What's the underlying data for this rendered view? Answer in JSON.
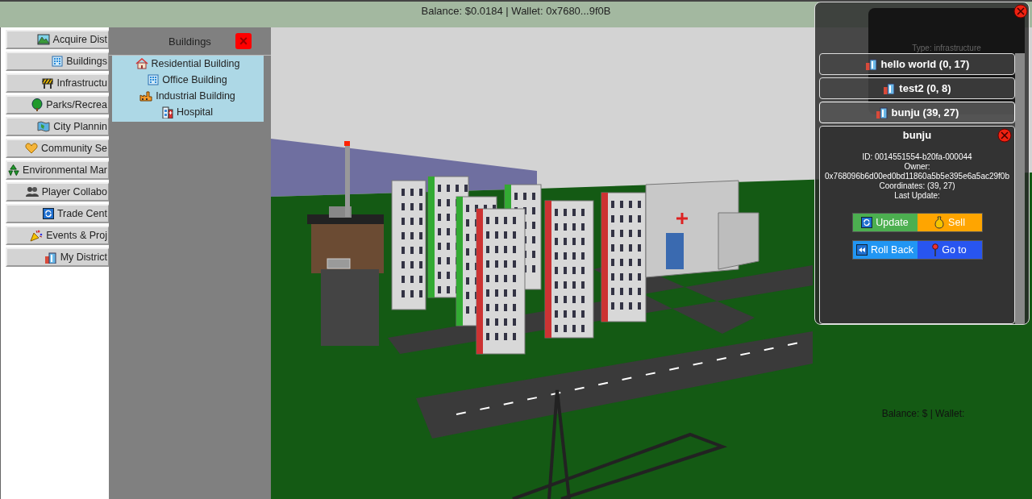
{
  "top_bar": {
    "text": "Balance: $0.0184 | Wallet: 0x7680...9f0B"
  },
  "menu": {
    "items": [
      "Acquire Dist",
      "Buildings",
      "Infrastructu",
      "Parks/Recrea",
      "City Plannin",
      "Community Se",
      "Environmental Mar",
      "Player Collabo",
      "Trade Cent",
      "Events & Proj",
      "My District"
    ]
  },
  "buildings_panel": {
    "title": "Buildings",
    "close": "×",
    "items": [
      "Residential Building",
      "Office Building",
      "Industrial Building",
      "Hospital"
    ]
  },
  "districts_panel": {
    "back_card": {
      "text": "Type: infrastructure"
    },
    "districts": [
      {
        "label": "hello world (0, 17)",
        "expanded": false
      },
      {
        "label": "test2 (0, 8)",
        "expanded": false
      },
      {
        "label": "bunju (39, 27)",
        "expanded": true
      }
    ],
    "detail": {
      "title": "bunju",
      "lines": [
        "ID: 0014551554-b20fa-000044",
        "Owner:",
        "0x768096b6d00ed0bd11860a5b5e395e6a5ac29f0b",
        "Coordinates: (39, 27)",
        "Last Update:"
      ],
      "button_rows": [
        [
          {
            "label": "Update",
            "color": "#4caf50"
          },
          {
            "label": "Sell",
            "color": "#ffa500"
          }
        ],
        [
          {
            "label": "Roll Back",
            "color": "#2196f3"
          },
          {
            "label": "Go to",
            "color": "#2855f0"
          }
        ]
      ]
    }
  },
  "footer": {
    "text": "Balance: $ | Wallet:"
  }
}
